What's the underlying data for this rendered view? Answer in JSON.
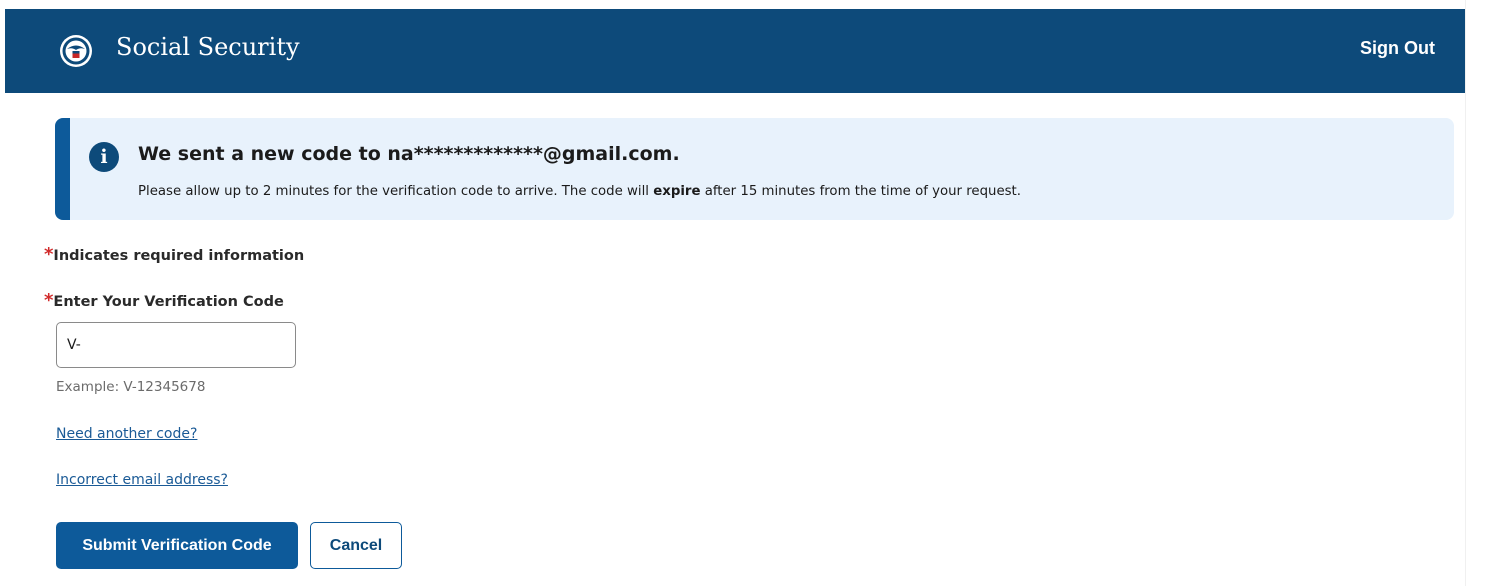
{
  "header": {
    "site_title": "Social Security",
    "logo_icon": "ssa-seal-icon",
    "sign_out_label": "Sign Out",
    "background_color": "#0d4a7a"
  },
  "alert": {
    "icon": "info-icon",
    "icon_glyph": "i",
    "title": "We sent a new code to na*************@gmail.com.",
    "body_before": "Please allow up to 2 minutes for the verification code to arrive. The code will ",
    "body_emphasis": "expire",
    "body_after": " after 15 minutes from the time of your request.",
    "background_color": "#e8f2fc",
    "accent_color": "#0d5a9a"
  },
  "form": {
    "required_marker": "*",
    "required_note": "Indicates required information",
    "code_label": "Enter Your Verification Code",
    "code_value": "V-",
    "code_hint": "Example: V-12345678"
  },
  "links": {
    "need_another_code": "Need another code?",
    "incorrect_email": "Incorrect email address?"
  },
  "actions": {
    "submit_label": "Submit Verification Code",
    "cancel_label": "Cancel",
    "primary_color": "#0d5a9a"
  }
}
